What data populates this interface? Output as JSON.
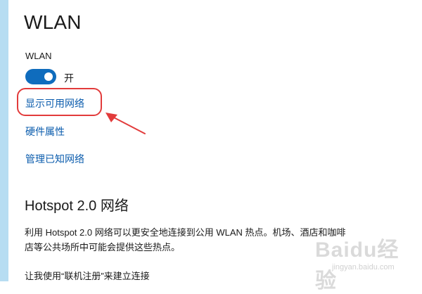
{
  "page": {
    "title": "WLAN"
  },
  "wlan": {
    "label": "WLAN",
    "toggle_state": "开"
  },
  "links": [
    "显示可用网络",
    "硬件属性",
    "管理已知网络"
  ],
  "hotspot": {
    "title": "Hotspot 2.0 网络",
    "description": "利用 Hotspot 2.0 网络可以更安全地连接到公用 WLAN 热点。机场、酒店和咖啡店等公共场所中可能会提供这些热点。",
    "bottom_text": "让我使用“联机注册”来建立连接"
  },
  "annotation": {
    "target_link": "显示可用网络",
    "highlight_color": "#e23b3b"
  },
  "watermark": {
    "text": "Baidu经验",
    "subtext": "jingyan.baidu.com"
  },
  "colors": {
    "accent": "#0f6cbd",
    "link": "#0b5cad",
    "left_strip": "#b7ddf2"
  },
  "icons": {
    "toggle": "toggle-on-icon",
    "arrow": "arrow-icon"
  }
}
